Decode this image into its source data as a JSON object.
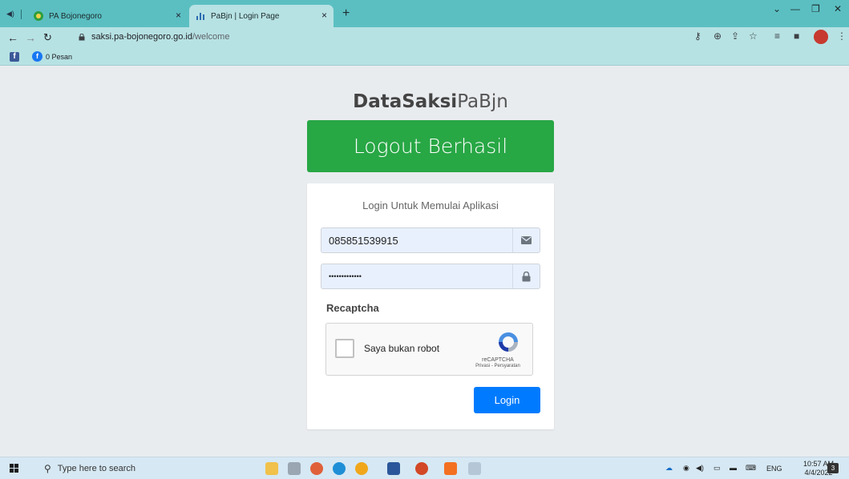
{
  "browser": {
    "tabs": [
      {
        "label": "PA Bojonegoro",
        "active": false
      },
      {
        "label": "PaBjn | Login Page",
        "active": true
      }
    ],
    "close_glyph": "×",
    "new_tab_glyph": "+",
    "address": {
      "domain": "saksi.pa-bojonegoro.go.id",
      "path": "/welcome"
    },
    "bookmarks": [
      {
        "label": "0 Pesan"
      }
    ],
    "colors": {
      "tabbar": "#5bbfc2",
      "toolbar": "#b7e2e4"
    }
  },
  "app": {
    "brand": {
      "bold": "DataSaksi",
      "light": "PaBjn"
    },
    "alert": {
      "text": "Logout Berhasil",
      "color": "#28a745"
    },
    "login": {
      "message": "Login Untuk Memulai Aplikasi",
      "username_value": "085851539915",
      "password_value": "•••••••••••••",
      "recaptcha_label": "Recaptcha",
      "captcha": {
        "checkbox_label": "Saya bukan robot",
        "brand": "reCAPTCHA",
        "links": "Privasi - Persyaratan"
      },
      "submit_label": "Login",
      "submit_color": "#007bff"
    }
  },
  "taskbar": {
    "search_placeholder": "Type here to search",
    "language": "ENG",
    "time": "10:57 AM",
    "date": "4/4/2022",
    "notification_count": "3"
  }
}
